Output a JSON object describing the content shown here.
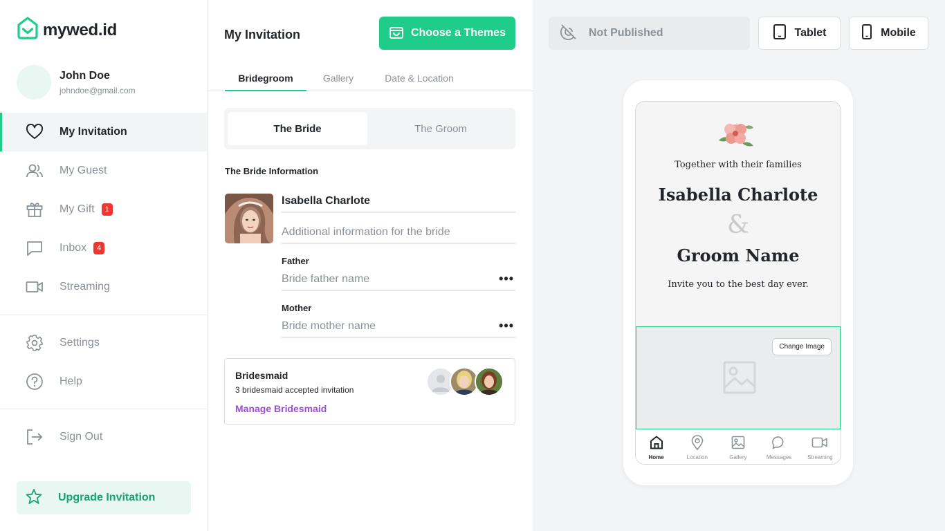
{
  "brand": {
    "name": "mywed.id",
    "accent": "#1fcc8a"
  },
  "user": {
    "name": "John Doe",
    "email": "johndoe@gmail.com"
  },
  "sidebar": {
    "items": [
      {
        "label": "My Invitation",
        "icon": "heart-icon"
      },
      {
        "label": "My Guest",
        "icon": "users-icon"
      },
      {
        "label": "My Gift",
        "icon": "gift-icon",
        "badge": "1"
      },
      {
        "label": "Inbox",
        "icon": "message-icon",
        "badge": "4"
      },
      {
        "label": "Streaming",
        "icon": "video-icon"
      }
    ],
    "secondary": [
      {
        "label": "Settings",
        "icon": "gear-icon"
      },
      {
        "label": "Help",
        "icon": "help-icon"
      }
    ],
    "signout": "Sign Out",
    "upgrade": "Upgrade Invitation"
  },
  "editor": {
    "title": "My Invitation",
    "choose_theme": "Choose a Themes",
    "tabs": [
      "Bridegroom",
      "Gallery",
      "Date & Location"
    ],
    "segment": [
      "The Bride",
      "The Groom"
    ],
    "section_title": "The Bride Information",
    "bride_name": "Isabella Charlote",
    "additional_placeholder": "Additional information for the bride",
    "father_label": "Father",
    "father_placeholder": "Bride father name",
    "mother_label": "Mother",
    "mother_placeholder": "Bride mother name",
    "bridesmaid": {
      "title": "Bridesmaid",
      "subtitle": "3 bridesmaid accepted invitation",
      "link": "Manage Bridesmaid"
    }
  },
  "preview": {
    "status": "Not Published",
    "devices": [
      "Tablet",
      "Mobile"
    ],
    "invitation": {
      "intro": "Together with their families",
      "bride": "Isabella Charlote",
      "amp": "&",
      "groom": "Groom Name",
      "tagline": "Invite you to the best day ever."
    },
    "change_image": "Change Image",
    "nav": [
      "Home",
      "Location",
      "Gallery",
      "Messages",
      "Streaming"
    ]
  }
}
